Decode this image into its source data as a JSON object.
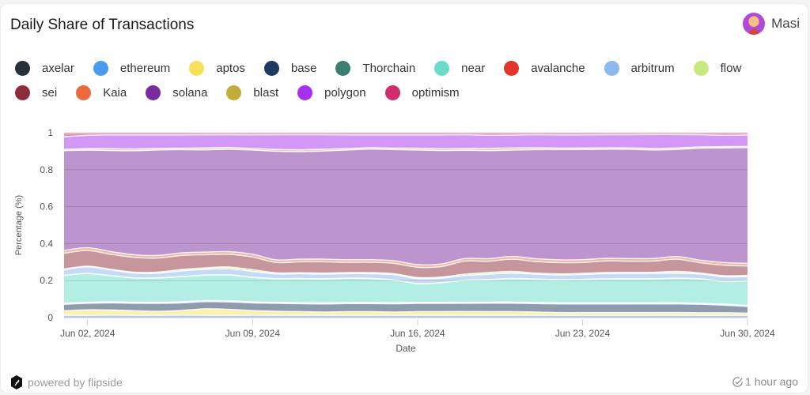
{
  "header": {
    "title": "Daily Share of Transactions",
    "user_name": "Masi",
    "avatar_icon": "user-avatar"
  },
  "legend": {
    "rows": [
      [
        {
          "label": "axelar",
          "color": "#263238"
        },
        {
          "label": "ethereum",
          "color": "#4a9bf2"
        },
        {
          "label": "aptos",
          "color": "#f7e15a"
        },
        {
          "label": "base",
          "color": "#1f3a5f"
        },
        {
          "label": "Thorchain",
          "color": "#3a7f76"
        },
        {
          "label": "near",
          "color": "#67ddca"
        },
        {
          "label": "avalanche",
          "color": "#e4352a"
        },
        {
          "label": "arbitrum",
          "color": "#8ab8ef"
        },
        {
          "label": "flow",
          "color": "#c7ea7e"
        }
      ],
      [
        {
          "label": "sei",
          "color": "#8e2d3a"
        },
        {
          "label": "Kaia",
          "color": "#ec6a3c"
        },
        {
          "label": "solana",
          "color": "#7a2ba0"
        },
        {
          "label": "blast",
          "color": "#c2ac3a"
        },
        {
          "label": "polygon",
          "color": "#a72ff0"
        },
        {
          "label": "optimism",
          "color": "#d12c6e"
        }
      ]
    ]
  },
  "chart_data": {
    "type": "area",
    "stacked": true,
    "normalized": true,
    "title": "Daily Share of Transactions",
    "xlabel": "Date",
    "ylabel": "Percentage (%)",
    "ylim": [
      0,
      1
    ],
    "yticks": [
      0,
      0.2,
      0.4,
      0.6,
      0.8,
      1
    ],
    "ytick_labels": [
      "0",
      "0.2",
      "0.4",
      "0.6",
      "0.8",
      "1"
    ],
    "xlim": [
      "2024-06-01",
      "2024-06-30"
    ],
    "xticks": [
      "2024-06-02",
      "2024-06-09",
      "2024-06-16",
      "2024-06-23",
      "2024-06-30"
    ],
    "xtick_labels": [
      "Jun 02, 2024",
      "Jun 09, 2024",
      "Jun 16, 2024",
      "Jun 23, 2024",
      "Jun 30, 2024"
    ],
    "grid": "horizontal",
    "legend_position": "top",
    "fill_opacity": 0.5,
    "x": [
      "2024-06-01",
      "2024-06-02",
      "2024-06-03",
      "2024-06-04",
      "2024-06-05",
      "2024-06-06",
      "2024-06-07",
      "2024-06-08",
      "2024-06-09",
      "2024-06-10",
      "2024-06-11",
      "2024-06-12",
      "2024-06-13",
      "2024-06-14",
      "2024-06-15",
      "2024-06-16",
      "2024-06-17",
      "2024-06-18",
      "2024-06-19",
      "2024-06-20",
      "2024-06-21",
      "2024-06-22",
      "2024-06-23",
      "2024-06-24",
      "2024-06-25",
      "2024-06-26",
      "2024-06-27",
      "2024-06-28",
      "2024-06-29",
      "2024-06-30"
    ],
    "series": [
      {
        "name": "ethereum",
        "color": "#4a9bf2",
        "values": [
          0.012,
          0.012,
          0.013,
          0.012,
          0.012,
          0.013,
          0.012,
          0.012,
          0.012,
          0.012,
          0.012,
          0.012,
          0.012,
          0.012,
          0.012,
          0.012,
          0.012,
          0.012,
          0.012,
          0.012,
          0.012,
          0.012,
          0.012,
          0.012,
          0.012,
          0.012,
          0.012,
          0.012,
          0.012,
          0.012
        ]
      },
      {
        "name": "aptos",
        "color": "#f7e15a",
        "values": [
          0.025,
          0.03,
          0.028,
          0.025,
          0.022,
          0.026,
          0.035,
          0.032,
          0.025,
          0.022,
          0.02,
          0.018,
          0.02,
          0.02,
          0.018,
          0.02,
          0.02,
          0.021,
          0.02,
          0.02,
          0.018,
          0.015,
          0.015,
          0.015,
          0.015,
          0.015,
          0.015,
          0.014,
          0.014,
          0.012
        ]
      },
      {
        "name": "base",
        "color": "#1f3a5f",
        "values": [
          0.035,
          0.035,
          0.038,
          0.04,
          0.042,
          0.04,
          0.038,
          0.04,
          0.04,
          0.042,
          0.042,
          0.043,
          0.043,
          0.043,
          0.044,
          0.044,
          0.044,
          0.044,
          0.045,
          0.045,
          0.045,
          0.046,
          0.046,
          0.046,
          0.046,
          0.046,
          0.046,
          0.045,
          0.04,
          0.035
        ]
      },
      {
        "name": "axelar",
        "color": "#263238",
        "values": [
          0.004,
          0.004,
          0.004,
          0.004,
          0.004,
          0.004,
          0.004,
          0.004,
          0.004,
          0.004,
          0.004,
          0.004,
          0.004,
          0.004,
          0.004,
          0.004,
          0.004,
          0.004,
          0.004,
          0.004,
          0.004,
          0.004,
          0.004,
          0.004,
          0.004,
          0.004,
          0.004,
          0.004,
          0.004,
          0.004
        ]
      },
      {
        "name": "Thorchain",
        "color": "#3a7f76",
        "values": [
          0.002,
          0.002,
          0.002,
          0.002,
          0.002,
          0.002,
          0.002,
          0.002,
          0.002,
          0.002,
          0.002,
          0.002,
          0.002,
          0.002,
          0.002,
          0.002,
          0.002,
          0.002,
          0.002,
          0.002,
          0.002,
          0.002,
          0.002,
          0.002,
          0.002,
          0.002,
          0.002,
          0.002,
          0.002,
          0.002
        ]
      },
      {
        "name": "near",
        "color": "#67ddca",
        "values": [
          0.15,
          0.155,
          0.14,
          0.13,
          0.13,
          0.135,
          0.135,
          0.138,
          0.128,
          0.125,
          0.128,
          0.128,
          0.13,
          0.128,
          0.12,
          0.1,
          0.105,
          0.118,
          0.12,
          0.125,
          0.125,
          0.123,
          0.125,
          0.128,
          0.128,
          0.128,
          0.13,
          0.13,
          0.12,
          0.13
        ]
      },
      {
        "name": "avalanche",
        "color": "#e4352a",
        "values": [
          0.001,
          0.001,
          0.001,
          0.001,
          0.001,
          0.001,
          0.001,
          0.001,
          0.001,
          0.001,
          0.001,
          0.001,
          0.001,
          0.001,
          0.001,
          0.001,
          0.001,
          0.001,
          0.001,
          0.001,
          0.001,
          0.001,
          0.001,
          0.001,
          0.001,
          0.001,
          0.001,
          0.001,
          0.001,
          0.001
        ]
      },
      {
        "name": "arbitrum",
        "color": "#8ab8ef",
        "values": [
          0.03,
          0.035,
          0.03,
          0.025,
          0.025,
          0.03,
          0.03,
          0.032,
          0.03,
          0.025,
          0.025,
          0.025,
          0.024,
          0.025,
          0.028,
          0.026,
          0.024,
          0.025,
          0.028,
          0.028,
          0.026,
          0.025,
          0.026,
          0.028,
          0.028,
          0.028,
          0.026,
          0.025,
          0.024,
          0.022
        ]
      },
      {
        "name": "flow",
        "color": "#c7ea7e",
        "values": [
          0.004,
          0.004,
          0.004,
          0.005,
          0.006,
          0.008,
          0.008,
          0.01,
          0.01,
          0.006,
          0.006,
          0.006,
          0.006,
          0.006,
          0.006,
          0.006,
          0.006,
          0.008,
          0.01,
          0.01,
          0.006,
          0.006,
          0.006,
          0.006,
          0.006,
          0.006,
          0.01,
          0.006,
          0.006,
          0.006
        ]
      },
      {
        "name": "sei",
        "color": "#8e2d3a",
        "values": [
          0.085,
          0.085,
          0.08,
          0.08,
          0.075,
          0.075,
          0.07,
          0.068,
          0.066,
          0.055,
          0.058,
          0.06,
          0.055,
          0.055,
          0.055,
          0.055,
          0.056,
          0.07,
          0.06,
          0.065,
          0.062,
          0.06,
          0.058,
          0.062,
          0.06,
          0.06,
          0.065,
          0.055,
          0.056,
          0.05
        ]
      },
      {
        "name": "Kaia",
        "color": "#ec6a3c",
        "values": [
          0.015,
          0.015,
          0.015,
          0.014,
          0.014,
          0.014,
          0.014,
          0.014,
          0.015,
          0.014,
          0.014,
          0.014,
          0.014,
          0.014,
          0.014,
          0.014,
          0.014,
          0.014,
          0.014,
          0.015,
          0.015,
          0.015,
          0.015,
          0.014,
          0.014,
          0.014,
          0.014,
          0.014,
          0.014,
          0.014
        ]
      },
      {
        "name": "solana",
        "color": "#7a2ba0",
        "values": [
          0.54,
          0.528,
          0.545,
          0.56,
          0.565,
          0.555,
          0.545,
          0.548,
          0.548,
          0.58,
          0.575,
          0.58,
          0.59,
          0.592,
          0.595,
          0.615,
          0.61,
          0.585,
          0.58,
          0.568,
          0.585,
          0.59,
          0.59,
          0.585,
          0.585,
          0.58,
          0.57,
          0.6,
          0.61,
          0.615
        ]
      },
      {
        "name": "blast",
        "color": "#c2ac3a",
        "values": [
          0.007,
          0.008,
          0.01,
          0.01,
          0.008,
          0.008,
          0.01,
          0.01,
          0.008,
          0.01,
          0.01,
          0.01,
          0.008,
          0.008,
          0.008,
          0.01,
          0.01,
          0.01,
          0.012,
          0.012,
          0.01,
          0.008,
          0.008,
          0.008,
          0.008,
          0.008,
          0.008,
          0.007,
          0.007,
          0.006
        ]
      },
      {
        "name": "polygon",
        "color": "#a72ff0",
        "values": [
          0.068,
          0.072,
          0.074,
          0.075,
          0.072,
          0.071,
          0.07,
          0.068,
          0.072,
          0.078,
          0.08,
          0.077,
          0.073,
          0.068,
          0.07,
          0.071,
          0.074,
          0.074,
          0.07,
          0.068,
          0.07,
          0.07,
          0.07,
          0.07,
          0.07,
          0.074,
          0.071,
          0.065,
          0.06,
          0.061
        ]
      },
      {
        "name": "optimism",
        "color": "#d12c6e",
        "values": [
          0.022,
          0.014,
          0.012,
          0.012,
          0.012,
          0.012,
          0.011,
          0.011,
          0.011,
          0.011,
          0.011,
          0.011,
          0.012,
          0.012,
          0.012,
          0.012,
          0.012,
          0.011,
          0.014,
          0.013,
          0.011,
          0.012,
          0.012,
          0.011,
          0.011,
          0.01,
          0.01,
          0.011,
          0.014,
          0.012
        ]
      }
    ]
  },
  "footer": {
    "powered_by": "powered by flipside",
    "updated": "1 hour ago",
    "logo_icon": "flipside-logo",
    "check_icon": "check-circle"
  }
}
